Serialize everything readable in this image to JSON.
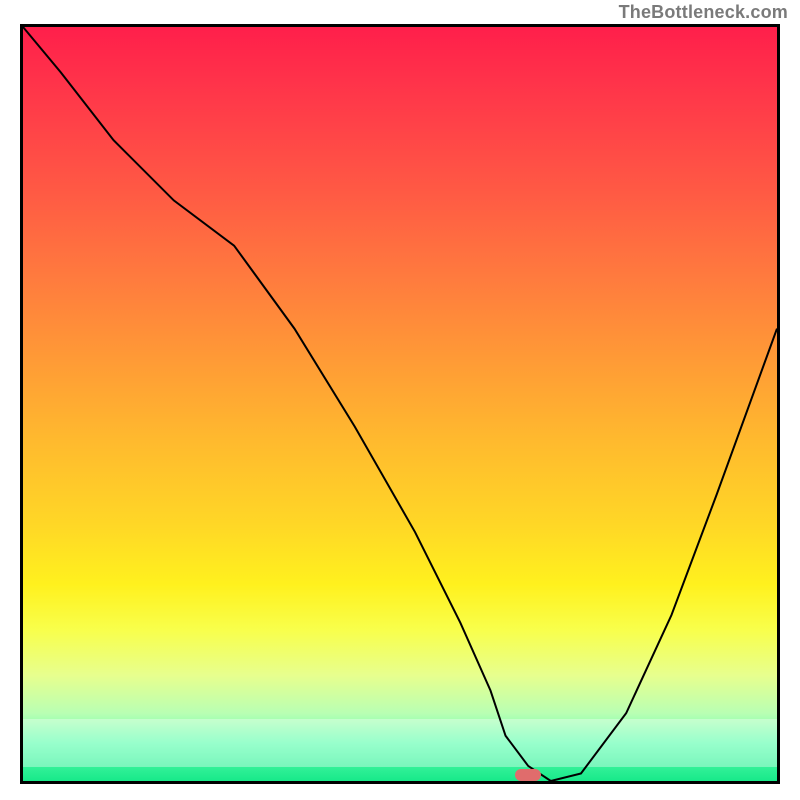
{
  "attribution": "TheBottleneck.com",
  "chart_data": {
    "type": "line",
    "title": "",
    "xlabel": "",
    "ylabel": "",
    "xlim": [
      0,
      100
    ],
    "ylim": [
      0,
      100
    ],
    "x": [
      0,
      5,
      12,
      20,
      28,
      36,
      44,
      52,
      58,
      62,
      64,
      67,
      70,
      74,
      80,
      86,
      92,
      100
    ],
    "values": [
      100,
      94,
      85,
      77,
      71,
      60,
      47,
      33,
      21,
      12,
      6,
      2,
      0,
      1,
      9,
      22,
      38,
      60
    ],
    "sweet_spot_x": 67,
    "sweet_spot_y": 0.8
  },
  "colors": {
    "curve": "#000000",
    "border": "#000000",
    "spot": "#e06c6c"
  }
}
